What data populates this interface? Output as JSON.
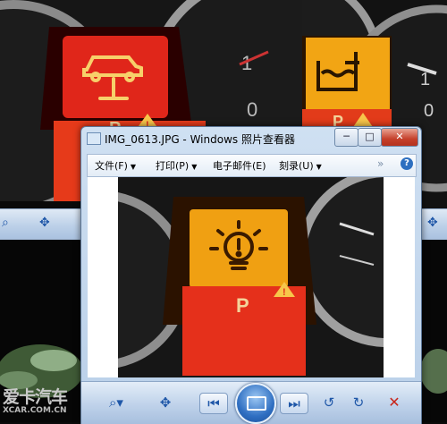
{
  "window": {
    "title": "IMG_0613.JPG - Windows 照片查看器",
    "minimize_glyph": "─",
    "maximize_glyph": "□",
    "close_glyph": "✕"
  },
  "menu": {
    "file": "文件(F)",
    "print": "打印(P)",
    "email": "电子邮件(E)",
    "burn": "刻录(U)",
    "more": "»",
    "help": "?"
  },
  "toolbar": {
    "zoom_glyph": "⌕▾",
    "fit_glyph": "✥",
    "prev_glyph": "⏮",
    "next_glyph": "⏭",
    "rotate_left_glyph": "↺",
    "rotate_right_glyph": "↻",
    "delete_glyph": "✕"
  },
  "photos": {
    "left_indicator": "P",
    "right_indicator": "P",
    "main_indicator": "P"
  },
  "watermark": {
    "logo": "爱卡汽车",
    "site": "XCAR.COM.CN"
  },
  "icons": {
    "car-lift-warning": "car-on-lift-icon",
    "coolant-warning": "coolant-level-icon",
    "lamp-failure-warning": "bulb-failure-icon",
    "warning-triangle": "warning-triangle-icon"
  },
  "colors": {
    "warning_red": "#e0261a",
    "warning_amber": "#f2a514",
    "window_chrome": "#c2d6ec"
  }
}
